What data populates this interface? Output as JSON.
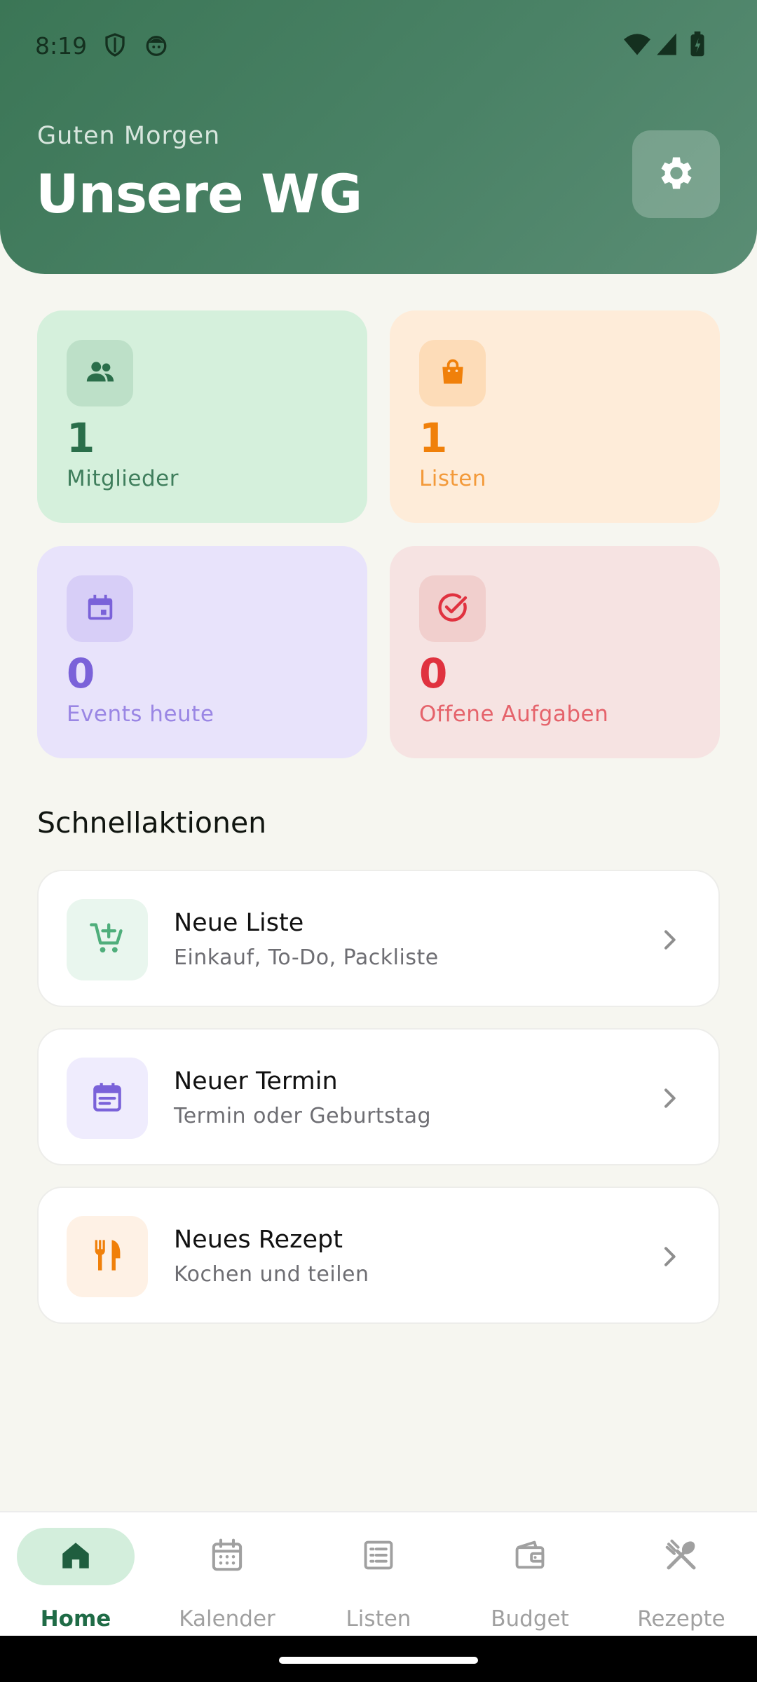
{
  "status_bar": {
    "time": "8:19"
  },
  "header": {
    "greeting": "Guten Morgen",
    "title": "Unsere WG",
    "settings_icon": "gear-icon"
  },
  "stats": [
    {
      "value": "1",
      "label": "Mitglieder",
      "icon": "group-icon",
      "bg": "#d5f0dc",
      "icon_bg": "#bde0c8",
      "color": "#2a6e4a",
      "label_color": "#3f7e5c"
    },
    {
      "value": "1",
      "label": "Listen",
      "icon": "shopping-bag-icon",
      "bg": "#feecd9",
      "icon_bg": "#fddcb8",
      "color": "#f0800a",
      "label_color": "#f39a3a"
    },
    {
      "value": "0",
      "label": "Events heute",
      "icon": "calendar-icon",
      "bg": "#e8e3fb",
      "icon_bg": "#d7cef7",
      "color": "#7a62d9",
      "label_color": "#9a86e4"
    },
    {
      "value": "0",
      "label": "Offene Aufgaben",
      "icon": "check-circle-icon",
      "bg": "#f6e3e2",
      "icon_bg": "#f1cfcd",
      "color": "#e0323f",
      "label_color": "#e5636b"
    }
  ],
  "quick_actions": {
    "title": "Schnellaktionen",
    "items": [
      {
        "title": "Neue Liste",
        "subtitle": "Einkauf, To-Do, Packliste",
        "icon": "add-cart-icon",
        "icon_bg": "#e9f6ee",
        "icon_color": "#4fae7b"
      },
      {
        "title": "Neuer Termin",
        "subtitle": "Termin oder Geburtstag",
        "icon": "event-icon",
        "icon_bg": "#efecfd",
        "icon_color": "#7a62d9"
      },
      {
        "title": "Neues Rezept",
        "subtitle": "Kochen und teilen",
        "icon": "utensils-icon",
        "icon_bg": "#fef1e5",
        "icon_color": "#f0800a"
      }
    ]
  },
  "bottom_nav": [
    {
      "label": "Home",
      "icon": "home-icon",
      "active": true
    },
    {
      "label": "Kalender",
      "icon": "calendar-icon",
      "active": false
    },
    {
      "label": "Listen",
      "icon": "list-icon",
      "active": false
    },
    {
      "label": "Budget",
      "icon": "wallet-icon",
      "active": false
    },
    {
      "label": "Rezepte",
      "icon": "cutlery-icon",
      "active": false
    }
  ]
}
